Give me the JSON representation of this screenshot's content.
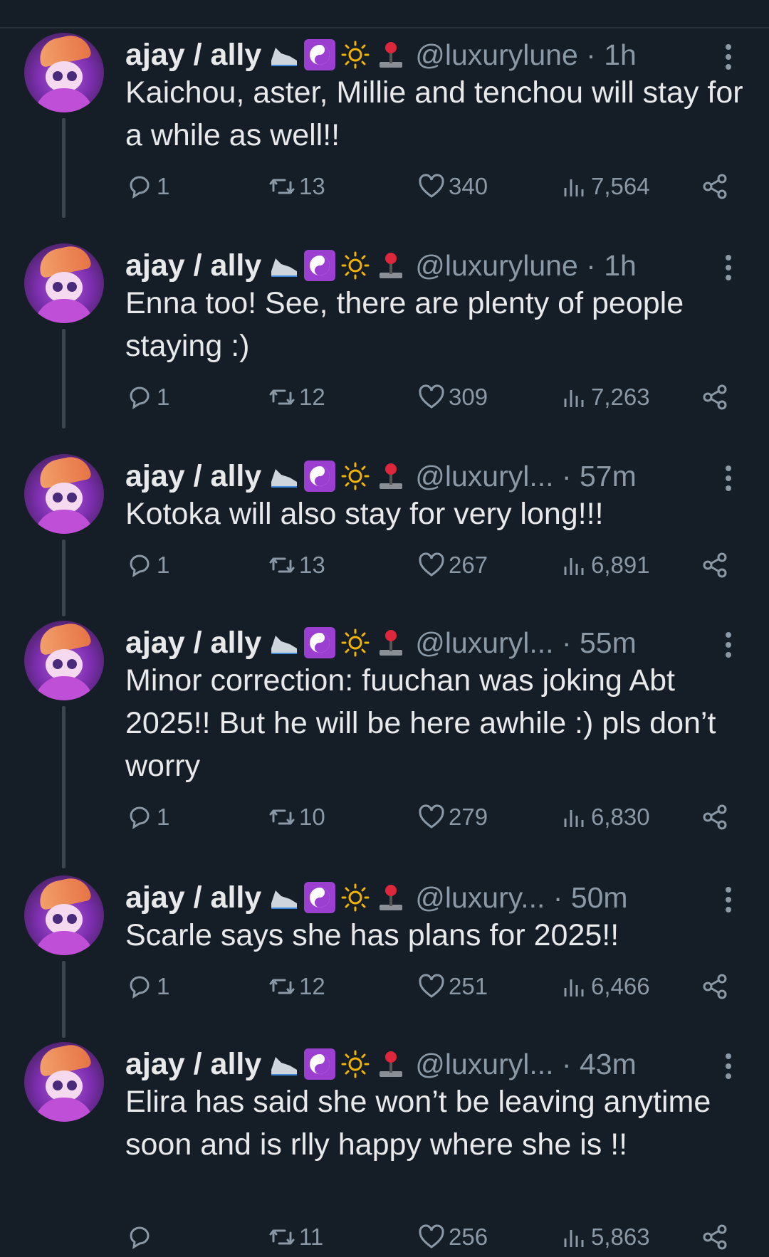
{
  "tweets": [
    {
      "name": "ajay / ally",
      "handle": "@luxurylune · 1h",
      "text": "Kaichou, aster, Millie and tenchou will stay for a while as well!!",
      "replies": "1",
      "retweets": "13",
      "likes": "340",
      "views": "7,564"
    },
    {
      "name": "ajay / ally",
      "handle": "@luxurylune · 1h",
      "text": "Enna too! See, there are plenty of people staying :)",
      "replies": "1",
      "retweets": "12",
      "likes": "309",
      "views": "7,263"
    },
    {
      "name": "ajay / ally",
      "handle": "@luxuryl... · 57m",
      "text": "Kotoka will also stay for very long!!!",
      "replies": "1",
      "retweets": "13",
      "likes": "267",
      "views": "6,891"
    },
    {
      "name": "ajay / ally",
      "handle": "@luxuryl... · 55m",
      "text": "Minor correction: fuuchan was joking Abt 2025!! But he will be here awhile :) pls don’t worry",
      "replies": "1",
      "retweets": "10",
      "likes": "279",
      "views": "6,830"
    },
    {
      "name": "ajay / ally",
      "handle": "@luxury...  · 50m",
      "text": "Scarle says she has plans for 2025!!",
      "replies": "1",
      "retweets": "12",
      "likes": "251",
      "views": "6,466"
    },
    {
      "name": "ajay / ally",
      "handle": "@luxuryl... · 43m",
      "text": "Elira has said she won’t be leaving anytime soon and is rlly happy where she is !!",
      "replies": "",
      "retweets": "11",
      "likes": "256",
      "views": "5,863"
    }
  ]
}
